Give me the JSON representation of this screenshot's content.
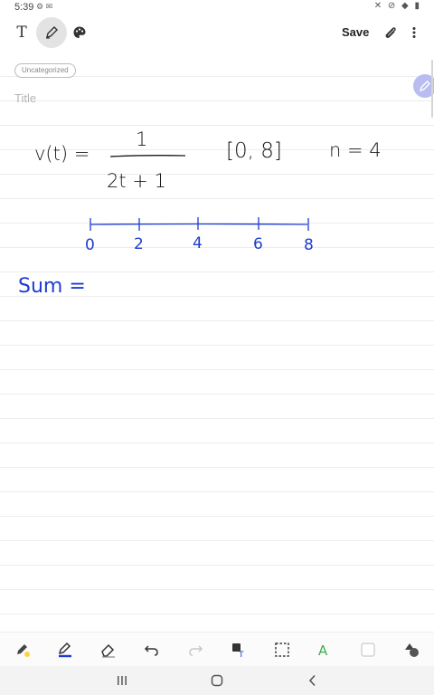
{
  "status": {
    "time": "5:39",
    "notif_icons": "⚙ ✉",
    "sys_icons": "✕ ⊘ ◆ ▮"
  },
  "toolbar": {
    "text_tool": "T",
    "save_label": "Save"
  },
  "note": {
    "category": "Uncategorized",
    "title_placeholder": "Title",
    "ink": {
      "function_lhs": "v(t) =",
      "numerator": "1",
      "denominator": "2t + 1",
      "interval": "[0, 8]",
      "n_value": "n = 4",
      "tick_labels": [
        "0",
        "2",
        "4",
        "6",
        "8"
      ],
      "sum_label": "Sum ="
    }
  },
  "colors": {
    "ink_black": "#1a1a1a",
    "ink_blue": "#1d3ccf",
    "fab": "#b8bcf0",
    "accent_highlight": "#ffd23f"
  },
  "bottom_tools": [
    "pen-settings-icon",
    "pen-icon",
    "eraser-icon",
    "undo-icon",
    "redo-icon",
    "text-convert-icon",
    "selection-icon",
    "shape-icon",
    "square-icon",
    "shapes-icon"
  ],
  "navigation": [
    "recents-icon",
    "home-icon",
    "back-icon"
  ]
}
